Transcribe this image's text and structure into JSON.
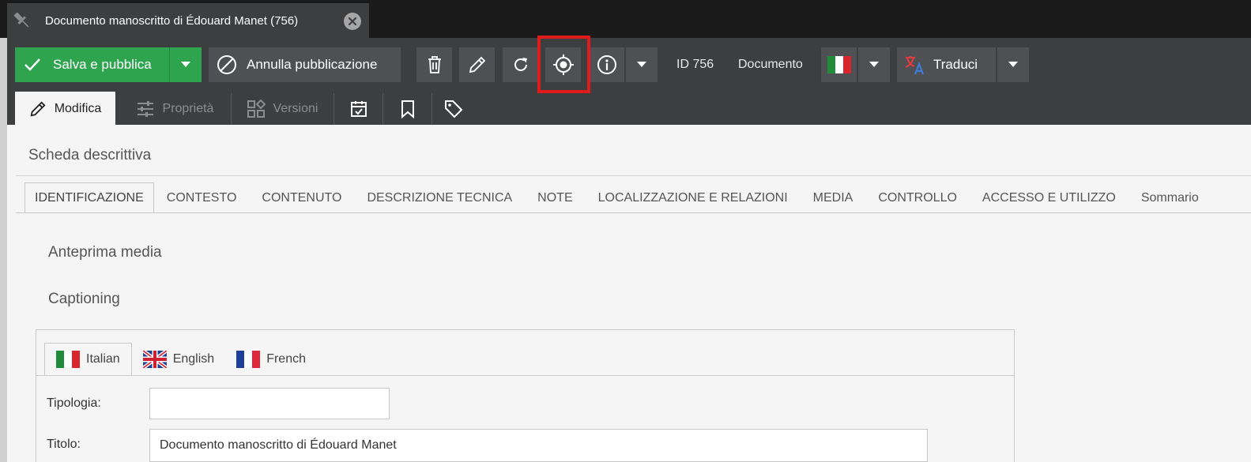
{
  "document_tab": {
    "title": "Documento manoscritto di Édouard Manet (756)"
  },
  "toolbar": {
    "save_publish_label": "Salva e pubblica",
    "unpublish_label": "Annulla pubblicazione",
    "id_text": "ID 756",
    "type_text": "Documento",
    "translate_label": "Traduci",
    "highlighted_button": "locate-button"
  },
  "subtabs": {
    "edit": "Modifica",
    "properties": "Proprietà",
    "versions": "Versioni"
  },
  "content": {
    "section_title": "Scheda descrittiva",
    "category_tabs": [
      "IDENTIFICAZIONE",
      "CONTESTO",
      "CONTENUTO",
      "DESCRIZIONE TECNICA",
      "NOTE",
      "LOCALIZZAZIONE E RELAZIONI",
      "MEDIA",
      "CONTROLLO",
      "ACCESSO E UTILIZZO",
      "Sommario"
    ],
    "media_preview_title": "Anteprima media",
    "captioning_title": "Captioning"
  },
  "languages": {
    "italian": "Italian",
    "english": "English",
    "french": "French"
  },
  "form": {
    "typology_label": "Tipologia:",
    "typology_value": "",
    "title_label": "Titolo:",
    "title_value": "Documento manoscritto di Édouard Manet"
  },
  "colors": {
    "accent_green": "#2ea44f",
    "highlight_red": "#e11b1b",
    "toolbar_bg": "#3d3e40"
  }
}
